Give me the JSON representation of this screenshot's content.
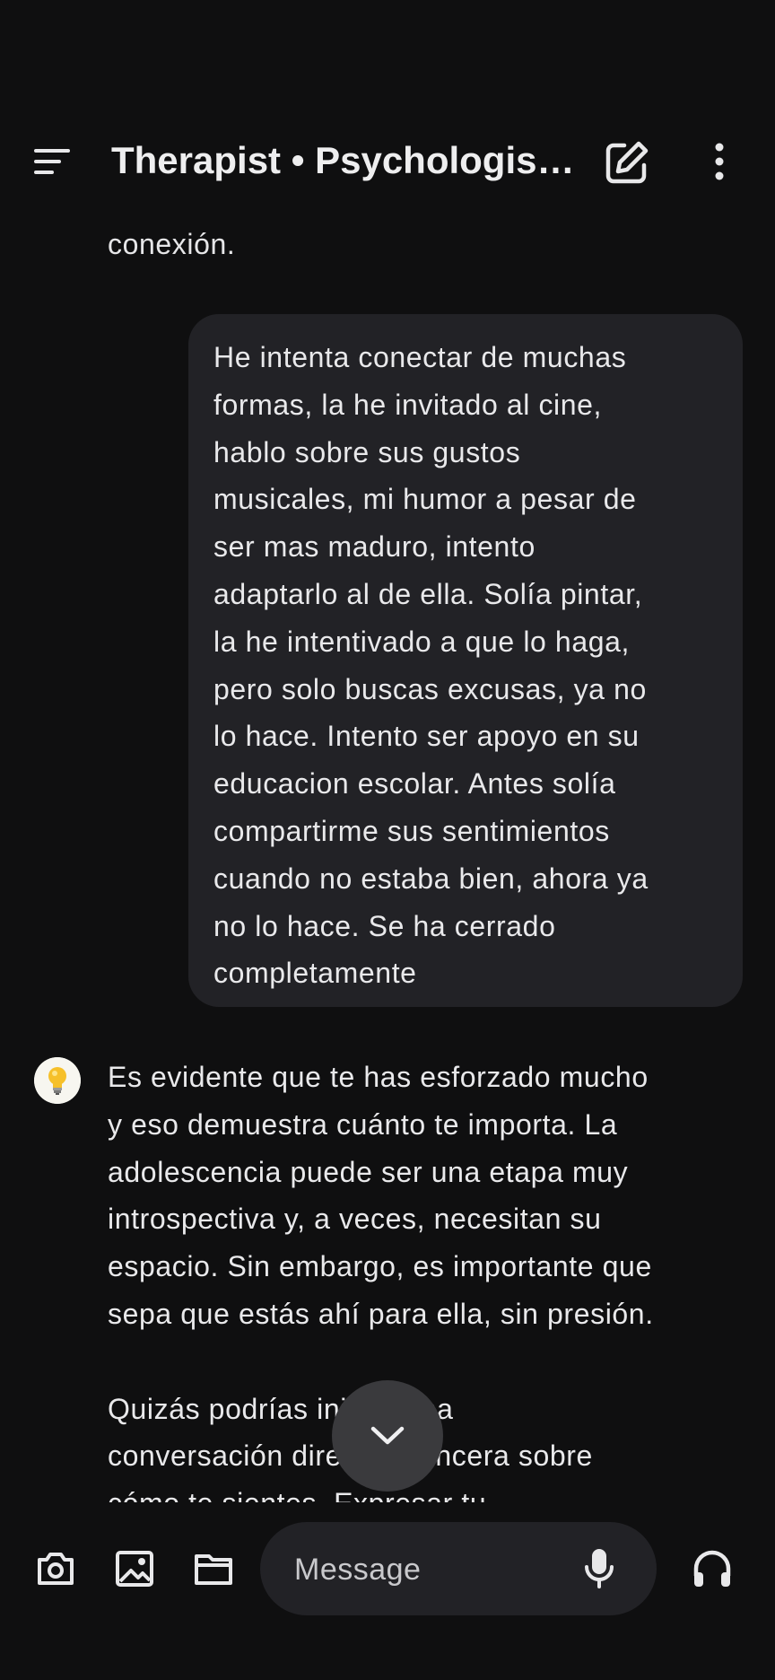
{
  "header": {
    "title": "Therapist • Psychologist…",
    "icons": [
      "menu-icon",
      "edit-icon",
      "more-vertical-icon"
    ]
  },
  "chat": {
    "previous_text": "conexión.",
    "user_message": {
      "lines": [
        "He intenta conectar de muchas",
        "formas, la he invitado al cine,",
        "hablo sobre sus gustos",
        "musicales, mi humor a pesar de",
        "ser mas maduro, intento",
        "adaptarlo al de ella. Solía pintar,",
        "la he intentivado a que lo haga,",
        "pero solo buscas excusas, ya no",
        "lo hace. Intento ser apoyo en su",
        "educacion escolar. Antes solía",
        "compartirme sus sentimientos",
        "cuando no estaba bien, ahora ya",
        "no lo hace. Se ha cerrado",
        "completamente"
      ]
    },
    "assistant_message": {
      "avatar_icon": "lightbulb-icon",
      "paragraph1": [
        "Es evidente que te has esforzado mucho",
        "y eso demuestra cuánto te importa. La",
        "adolescencia puede ser una etapa muy",
        "introspectiva y, a veces, necesitan su",
        "espacio. Sin embargo, es importante que",
        "sepa que estás ahí para ella, sin presión."
      ],
      "paragraph2": [
        "Quizás podrías iniciar una",
        "conversación directa y sincera sobre",
        "cómo te sientes. Expresar tu"
      ]
    },
    "scroll_down_icon": "chevron-down-icon"
  },
  "composer": {
    "placeholder": "Message",
    "icons": [
      "camera-icon",
      "image-icon",
      "folder-icon",
      "mic-icon",
      "headphones-icon"
    ]
  }
}
